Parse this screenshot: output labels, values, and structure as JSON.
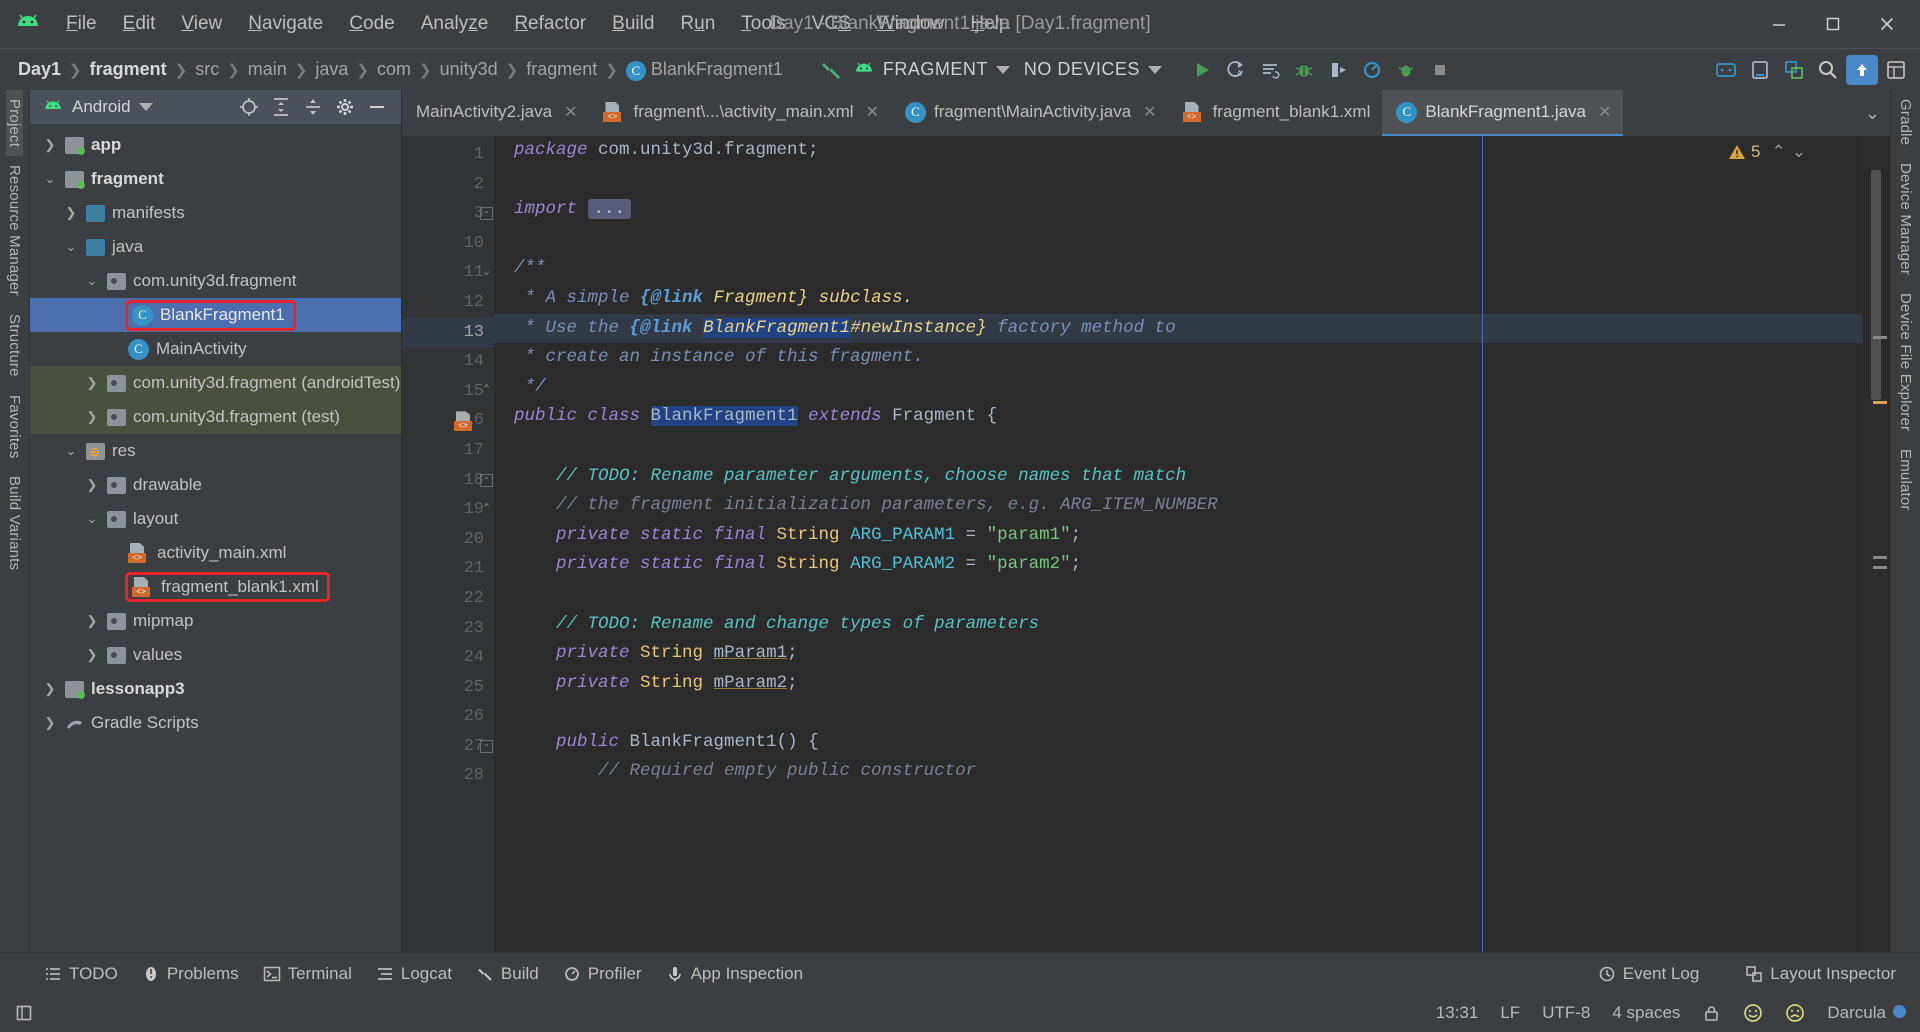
{
  "window": {
    "title": "Day1 - BlankFragment1.java [Day1.fragment]",
    "minimize": "–",
    "maximize": "❐",
    "close": "✕"
  },
  "menubar": {
    "logo": "android-logo-icon",
    "items": [
      {
        "label": "File",
        "mnemonic": "F"
      },
      {
        "label": "Edit",
        "mnemonic": "E"
      },
      {
        "label": "View",
        "mnemonic": "V"
      },
      {
        "label": "Navigate",
        "mnemonic": "N"
      },
      {
        "label": "Code",
        "mnemonic": "C"
      },
      {
        "label": "Analyze",
        "mnemonic": "z"
      },
      {
        "label": "Refactor",
        "mnemonic": "R"
      },
      {
        "label": "Build",
        "mnemonic": "B"
      },
      {
        "label": "Run",
        "mnemonic": "u"
      },
      {
        "label": "Tools",
        "mnemonic": "T"
      },
      {
        "label": "VCS",
        "mnemonic": "S"
      },
      {
        "label": "Window",
        "mnemonic": "W"
      },
      {
        "label": "Help",
        "mnemonic": "H"
      }
    ]
  },
  "navbar": {
    "breadcrumbs": [
      {
        "label": "Day1",
        "bold": true,
        "icon": null
      },
      {
        "label": "fragment",
        "bold": true,
        "icon": null
      },
      {
        "label": "src",
        "bold": false,
        "icon": null
      },
      {
        "label": "main",
        "bold": false,
        "icon": null
      },
      {
        "label": "java",
        "bold": false,
        "icon": null
      },
      {
        "label": "com",
        "bold": false,
        "icon": null
      },
      {
        "label": "unity3d",
        "bold": false,
        "icon": null
      },
      {
        "label": "fragment",
        "bold": false,
        "icon": null
      },
      {
        "label": "BlankFragment1",
        "bold": false,
        "icon": "class-icon"
      }
    ],
    "build_icon": "build-hammer-icon",
    "run_config": {
      "icon": "android-app-icon",
      "label": "FRAGMENT",
      "dropdown": "caret-down-icon"
    },
    "device": {
      "label": "NO DEVICES",
      "dropdown": "caret-down-icon"
    },
    "actions": [
      {
        "name": "run-button",
        "glyph": "▶"
      },
      {
        "name": "apply-changes-icon",
        "glyph": "↻"
      },
      {
        "name": "apply-code-changes-icon",
        "glyph": "≡"
      },
      {
        "name": "debug-button",
        "glyph": "🐞"
      },
      {
        "name": "attach-debugger-icon",
        "glyph": "◧"
      },
      {
        "name": "profiler-icon",
        "glyph": "◕"
      },
      {
        "name": "run-coverage-icon",
        "glyph": "🐜"
      },
      {
        "name": "stop-button",
        "glyph": "■"
      },
      {
        "name": "avd-manager-icon",
        "glyph": "▭"
      },
      {
        "name": "sdk-manager-icon",
        "glyph": "⬓"
      },
      {
        "name": "layout-inspector-icon",
        "glyph": "❏"
      },
      {
        "name": "search-everywhere-icon",
        "glyph": "🔍"
      },
      {
        "name": "sync-project-icon",
        "glyph": "⬆"
      },
      {
        "name": "project-structure-icon",
        "glyph": "▤"
      }
    ]
  },
  "left_rail": {
    "items": [
      {
        "label": "Project",
        "selected": true,
        "name": "rail-project"
      },
      {
        "label": "Resource Manager",
        "selected": false,
        "name": "rail-resource-manager"
      },
      {
        "label": "Structure",
        "selected": false,
        "name": "rail-structure"
      },
      {
        "label": "Favorites",
        "selected": false,
        "name": "rail-favorites"
      },
      {
        "label": "Build Variants",
        "selected": false,
        "name": "rail-build-variants"
      }
    ]
  },
  "right_rail": {
    "items": [
      {
        "label": "Gradle",
        "name": "rail-gradle"
      },
      {
        "label": "Device Manager",
        "name": "rail-device-manager"
      },
      {
        "label": "Device File Explorer",
        "name": "rail-device-file-explorer"
      },
      {
        "label": "Emulator",
        "name": "rail-emulator"
      }
    ]
  },
  "project_panel": {
    "header": {
      "icon": "android-logo-icon",
      "title": "Android",
      "dropdown": "caret-down-icon",
      "actions": [
        {
          "name": "select-opened-file-icon",
          "glyph": "⊕"
        },
        {
          "name": "expand-all-icon",
          "glyph": "⤓"
        },
        {
          "name": "collapse-all-icon",
          "glyph": "⤒"
        },
        {
          "name": "settings-gear-icon",
          "glyph": "⚙"
        },
        {
          "name": "hide-panel-icon",
          "glyph": "—"
        }
      ]
    },
    "tree": [
      {
        "label": "app",
        "indent": 0,
        "arrow": "collapsed",
        "icon": "module-folder",
        "bold": true,
        "state": "normal"
      },
      {
        "label": "fragment",
        "indent": 0,
        "arrow": "expanded",
        "icon": "module-folder",
        "bold": true,
        "state": "normal"
      },
      {
        "label": "manifests",
        "indent": 1,
        "arrow": "collapsed",
        "icon": "blue-folder",
        "bold": false,
        "state": "normal"
      },
      {
        "label": "java",
        "indent": 1,
        "arrow": "expanded",
        "icon": "blue-folder",
        "bold": false,
        "state": "normal"
      },
      {
        "label": "com.unity3d.fragment",
        "indent": 2,
        "arrow": "expanded",
        "icon": "package-folder",
        "bold": false,
        "state": "normal"
      },
      {
        "label": "BlankFragment1",
        "indent": 3,
        "arrow": "none",
        "icon": "class-icon",
        "bold": false,
        "state": "selected",
        "highlight": true
      },
      {
        "label": "MainActivity",
        "indent": 3,
        "arrow": "none",
        "icon": "class-icon",
        "bold": false,
        "state": "normal"
      },
      {
        "label": "com.unity3d.fragment (androidTest)",
        "indent": 2,
        "arrow": "collapsed",
        "icon": "package-folder",
        "bold": false,
        "state": "testscope"
      },
      {
        "label": "com.unity3d.fragment (test)",
        "indent": 2,
        "arrow": "collapsed",
        "icon": "package-folder",
        "bold": false,
        "state": "testscope"
      },
      {
        "label": "res",
        "indent": 1,
        "arrow": "expanded",
        "icon": "res-folder",
        "bold": false,
        "state": "normal"
      },
      {
        "label": "drawable",
        "indent": 2,
        "arrow": "collapsed",
        "icon": "package-folder",
        "bold": false,
        "state": "normal"
      },
      {
        "label": "layout",
        "indent": 2,
        "arrow": "expanded",
        "icon": "package-folder",
        "bold": false,
        "state": "normal"
      },
      {
        "label": "activity_main.xml",
        "indent": 3,
        "arrow": "none",
        "icon": "xml-icon",
        "bold": false,
        "state": "normal"
      },
      {
        "label": "fragment_blank1.xml",
        "indent": 3,
        "arrow": "none",
        "icon": "xml-icon",
        "bold": false,
        "state": "normal",
        "highlight": true
      },
      {
        "label": "mipmap",
        "indent": 2,
        "arrow": "collapsed",
        "icon": "package-folder",
        "bold": false,
        "state": "normal"
      },
      {
        "label": "values",
        "indent": 2,
        "arrow": "collapsed",
        "icon": "package-folder",
        "bold": false,
        "state": "normal"
      },
      {
        "label": "lessonapp3",
        "indent": 0,
        "arrow": "collapsed",
        "icon": "module-folder",
        "bold": true,
        "state": "normal"
      },
      {
        "label": "Gradle Scripts",
        "indent": 0,
        "arrow": "collapsed",
        "icon": "gradle-icon",
        "bold": false,
        "state": "normal"
      }
    ]
  },
  "editor": {
    "tabs": [
      {
        "label": "MainActivity2.java",
        "icon": null,
        "active": false,
        "closable": true
      },
      {
        "label": "fragment\\...\\activity_main.xml",
        "icon": "xml-icon",
        "active": false,
        "closable": true
      },
      {
        "label": "fragment\\MainActivity.java",
        "icon": "class-icon",
        "active": false,
        "closable": true
      },
      {
        "label": "fragment_blank1.xml",
        "icon": "xml-icon",
        "active": false,
        "closable": false
      },
      {
        "label": "BlankFragment1.java",
        "icon": "class-icon",
        "active": true,
        "closable": true
      }
    ],
    "tab_overflow_icon": "chevron-down-icon",
    "inspection": {
      "count": "5",
      "icon": "warning-triangle-icon",
      "up": "⌃",
      "down": "⌄"
    },
    "lines": [
      {
        "n": "1",
        "indent": 0,
        "tokens": [
          {
            "t": "package ",
            "c": "kw"
          },
          {
            "t": "com.unity3d.fragment;",
            "c": "plain"
          }
        ]
      },
      {
        "n": "2",
        "indent": 0,
        "tokens": []
      },
      {
        "n": "3",
        "indent": 0,
        "fold": "minus",
        "tokens": [
          {
            "t": "import ",
            "c": "kw"
          },
          {
            "t": "...",
            "c": "fold"
          }
        ]
      },
      {
        "n": "10",
        "indent": 0,
        "tokens": []
      },
      {
        "n": "11",
        "indent": 0,
        "fold": "doc-top",
        "tokens": [
          {
            "t": "/**",
            "c": "jdoc"
          }
        ]
      },
      {
        "n": "12",
        "indent": 0,
        "tokens": [
          {
            "t": " * A simple ",
            "c": "jdoc"
          },
          {
            "t": "{@link",
            "c": "jdoc-bold"
          },
          {
            "t": " Fragment} subclass.",
            "c": "jdoc-tag"
          }
        ]
      },
      {
        "n": "13",
        "indent": 0,
        "highlight": true,
        "tokens": [
          {
            "t": " * Use the ",
            "c": "jdoc"
          },
          {
            "t": "{@link",
            "c": "jdoc-bold"
          },
          {
            "t": " ",
            "c": "jdoc"
          },
          {
            "t": "BlankFragment1",
            "c": "jdoc-occ"
          },
          {
            "t": "#newInstance}",
            "c": "jdoc-tag"
          },
          {
            "t": " factory method to",
            "c": "jdoc"
          }
        ]
      },
      {
        "n": "14",
        "indent": 0,
        "tokens": [
          {
            "t": " * create an instance of this fragment.",
            "c": "jdoc"
          }
        ]
      },
      {
        "n": "15",
        "indent": 0,
        "fold": "doc-end",
        "tokens": [
          {
            "t": " */",
            "c": "jdoc"
          }
        ]
      },
      {
        "n": "16",
        "indent": 0,
        "gmark": "xml-icon",
        "tokens": [
          {
            "t": "public class ",
            "c": "kw"
          },
          {
            "t": "BlankFragment1",
            "c": "occ"
          },
          {
            "t": " ",
            "c": "plain"
          },
          {
            "t": "extends",
            "c": "kw"
          },
          {
            "t": " Fragment {",
            "c": "plain"
          }
        ]
      },
      {
        "n": "17",
        "indent": 0,
        "tokens": []
      },
      {
        "n": "18",
        "indent": 1,
        "fold": "minus",
        "tokens": [
          {
            "t": "    // TODO: Rename parameter arguments, choose names that match",
            "c": "todo"
          }
        ]
      },
      {
        "n": "19",
        "indent": 1,
        "fold": "end",
        "tokens": [
          {
            "t": "    // the fragment initialization parameters, e.g. ARG_ITEM_NUMBER",
            "c": "cmt"
          }
        ]
      },
      {
        "n": "20",
        "indent": 1,
        "tokens": [
          {
            "t": "    private static final ",
            "c": "kw"
          },
          {
            "t": "String",
            "c": "plain"
          },
          {
            "t": " ",
            "c": "plain"
          },
          {
            "t": "ARG_PARAM1",
            "c": "cnst"
          },
          {
            "t": " = ",
            "c": "plain"
          },
          {
            "t": "\"param1\"",
            "c": "str"
          },
          {
            "t": ";",
            "c": "plain"
          }
        ]
      },
      {
        "n": "21",
        "indent": 1,
        "tokens": [
          {
            "t": "    private static final ",
            "c": "kw"
          },
          {
            "t": "String",
            "c": "plain"
          },
          {
            "t": " ",
            "c": "plain"
          },
          {
            "t": "ARG_PARAM2",
            "c": "cnst"
          },
          {
            "t": " = ",
            "c": "plain"
          },
          {
            "t": "\"param2\"",
            "c": "str"
          },
          {
            "t": ";",
            "c": "plain"
          }
        ]
      },
      {
        "n": "22",
        "indent": 1,
        "tokens": []
      },
      {
        "n": "23",
        "indent": 1,
        "tokens": [
          {
            "t": "    // TODO: Rename and change types of parameters",
            "c": "todo"
          }
        ]
      },
      {
        "n": "24",
        "indent": 1,
        "tokens": [
          {
            "t": "    private ",
            "c": "kw"
          },
          {
            "t": "String",
            "c": "plain"
          },
          {
            "t": " ",
            "c": "plain"
          },
          {
            "t": "mParam1",
            "c": "fld-u"
          },
          {
            "t": ";",
            "c": "plain"
          }
        ]
      },
      {
        "n": "25",
        "indent": 1,
        "tokens": [
          {
            "t": "    private ",
            "c": "kw"
          },
          {
            "t": "String",
            "c": "plain"
          },
          {
            "t": " ",
            "c": "plain"
          },
          {
            "t": "mParam2",
            "c": "fld-u"
          },
          {
            "t": ";",
            "c": "plain"
          }
        ]
      },
      {
        "n": "26",
        "indent": 1,
        "tokens": []
      },
      {
        "n": "27",
        "indent": 1,
        "fold": "minus",
        "tokens": [
          {
            "t": "    public ",
            "c": "kw"
          },
          {
            "t": "BlankFragment1",
            "c": "plain"
          },
          {
            "t": "() {",
            "c": "plain"
          }
        ]
      },
      {
        "n": "28",
        "indent": 1,
        "tokens": [
          {
            "t": "        // Required empty public constructor",
            "c": "cmt"
          }
        ]
      }
    ]
  },
  "bottom_bar": {
    "items": [
      {
        "label": "TODO",
        "icon": "todo-list-icon"
      },
      {
        "label": "Problems",
        "icon": "problems-icon"
      },
      {
        "label": "Terminal",
        "icon": "terminal-icon"
      },
      {
        "label": "Logcat",
        "icon": "logcat-icon"
      },
      {
        "label": "Build",
        "icon": "build-hammer-icon"
      },
      {
        "label": "Profiler",
        "icon": "profiler-gauge-icon"
      },
      {
        "label": "App Inspection",
        "icon": "app-inspection-icon"
      }
    ],
    "right_items": [
      {
        "label": "Event Log",
        "icon": "event-log-icon"
      },
      {
        "label": "Layout Inspector",
        "icon": "layout-inspector-icon"
      }
    ]
  },
  "status_bar": {
    "left_icon": "hide-toolwindows-icon",
    "time": "13:31",
    "line_separator": "LF",
    "encoding": "UTF-8",
    "indent": "4 spaces",
    "lock_icon": "lock-icon",
    "happy_icon": "☺",
    "sad_icon": "☹",
    "theme": "Darcula",
    "theme_color": "#4a88c7"
  },
  "colors": {
    "accent": "#4a88c7",
    "selection": "#4b6eaf",
    "highlight_box": "#e8252a",
    "editor_bg": "#2b2b2b",
    "panel_bg": "#3c3f41",
    "green": "#5fb65f",
    "orange": "#d2692d"
  }
}
